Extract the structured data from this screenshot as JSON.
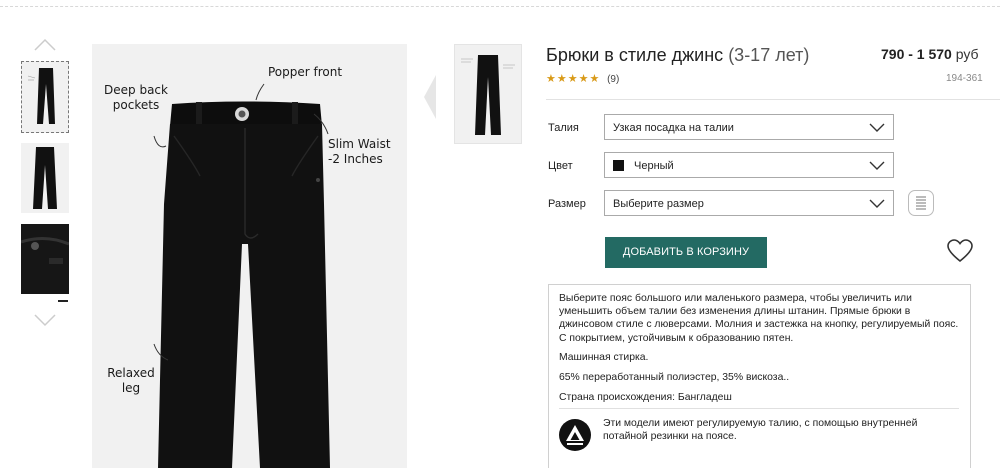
{
  "product": {
    "title": "Брюки в стиле джинс",
    "age_range": "(3-17 лет)",
    "price": "790 - 1 570",
    "currency": "руб",
    "rating_stars": "★★★★★",
    "rating_value": 4.5,
    "reviews_count": "(9)",
    "sku": "194-361"
  },
  "image_annotations": {
    "deep_back_pockets": "Deep back pockets",
    "popper_front": "Popper front",
    "slim_waist": "Slim Waist -2 Inches",
    "relaxed_leg": "Relaxed leg"
  },
  "options": {
    "waist": {
      "label": "Талия",
      "value": "Узкая посадка на талии"
    },
    "color": {
      "label": "Цвет",
      "value": "Черный",
      "swatch": "#111111"
    },
    "size": {
      "label": "Размер",
      "value": "Выберите размер"
    }
  },
  "add_to_cart_label": "ДОБАВИТЬ В КОРЗИНУ",
  "description": {
    "main": "Выберите пояс большого или маленького размера, чтобы увеличить или уменьшить объем талии без изменения длины штанин. Прямые брюки в джинсовом стиле с люверсами. Молния и застежка на кнопку, регулируемый пояс. С покрытием, устойчивым к образованию пятен.",
    "wash": "Машинная стирка.",
    "composition": "65% переработанный полиэстер, 35% вискоза..",
    "origin": "Страна происхождения: Бангладеш",
    "feature": "Эти модели имеют регулируемую талию, с помощью внутренней потайной резинки на поясе."
  },
  "colors": {
    "accent": "#236a63",
    "stars": "#d99a18",
    "image_bg": "#f1f1f1"
  },
  "icons": [
    "chevron-up-icon",
    "chevron-down-icon",
    "chevron-left-icon",
    "chevron-down-icon",
    "ruler-icon",
    "heart-icon",
    "adjustable-waist-icon"
  ]
}
